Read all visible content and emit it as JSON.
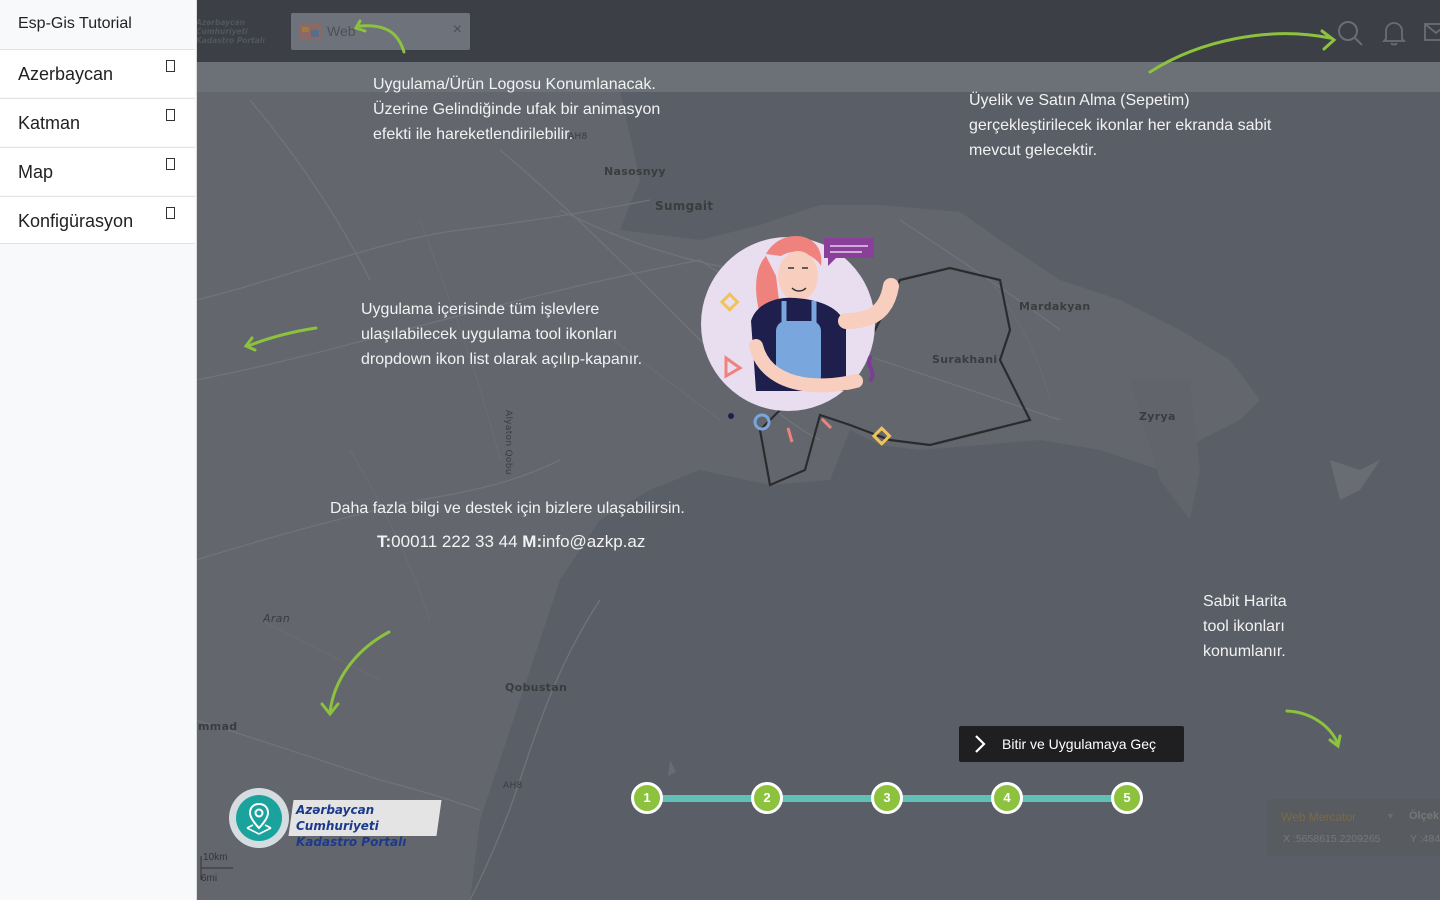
{
  "app": {
    "title": "Esp-Gis Tutorial"
  },
  "sidebar": {
    "items": [
      {
        "label": "Azerbaycan"
      },
      {
        "label": "Katman"
      },
      {
        "label": "Map"
      },
      {
        "label": "Konfigürasyon"
      }
    ]
  },
  "topbar": {
    "logo_text_line1": "Azərbaycan Cumhuriyeti",
    "logo_text_line2": "Kadastro Portalı",
    "tab_label": "Web",
    "tab_close": "×"
  },
  "map": {
    "places": [
      "Nasosnyy",
      "Sumgait",
      "Mardakyan",
      "Surakhani",
      "Zyrya",
      "Qobustan",
      "Aran",
      "mmad",
      "AH8",
      "Alyaton Qobu"
    ]
  },
  "notes": {
    "logo_note": [
      "Uygulama/Ürün Logosu Konumlanacak.",
      "Üzerine Gelindiğinde ufak bir animasyon",
      "efekti ile hareketlendirilebilir."
    ],
    "membership_note": [
      "Üyelik ve Satın Alma (Sepetim)",
      "gerçekleştirilecek ikonlar her ekranda sabit",
      "mevcut gelecektir."
    ],
    "tools_note": [
      "Uygulama içerisinde tüm işlevlere",
      "ulaşılabilecek uygulama tool ikonları",
      "dropdown ikon list olarak açılıp-kapanır."
    ],
    "map_tools_note": [
      "Sabit Harita",
      "tool ikonları",
      "konumlanır."
    ],
    "contact_line": "Daha fazla bilgi ve destek için bizlere ulaşabilirsin.",
    "phone_label": "T:",
    "phone": "00011 222 33 44",
    "mail_label": "M:",
    "mail": "info@azkp.az"
  },
  "finish_button": {
    "label": "Bitir ve Uygulamaya Geç"
  },
  "stepper": {
    "steps": [
      "1",
      "2",
      "3",
      "4",
      "5"
    ]
  },
  "portal_logo": {
    "line1": "Azərbaycan Cumhuriyeti",
    "line2": "Kadastro Portalı"
  },
  "projection": {
    "name": "Web Mercator",
    "arrow": "▼",
    "scale_label": "Ölçek",
    "x": "X :5658615.2209265",
    "y": "Y :484"
  },
  "scale": {
    "km": "10km",
    "mi": "6mi"
  },
  "colors": {
    "accent_green": "#8cc23e",
    "stepper_line": "#60c0b5",
    "topbar": "#3c3f45",
    "map_land": "#62666c",
    "map_sea": "#575b63"
  },
  "icons": [
    "search-icon",
    "bell-icon",
    "mail-icon",
    "chevron-right-icon",
    "map-pin-icon"
  ]
}
